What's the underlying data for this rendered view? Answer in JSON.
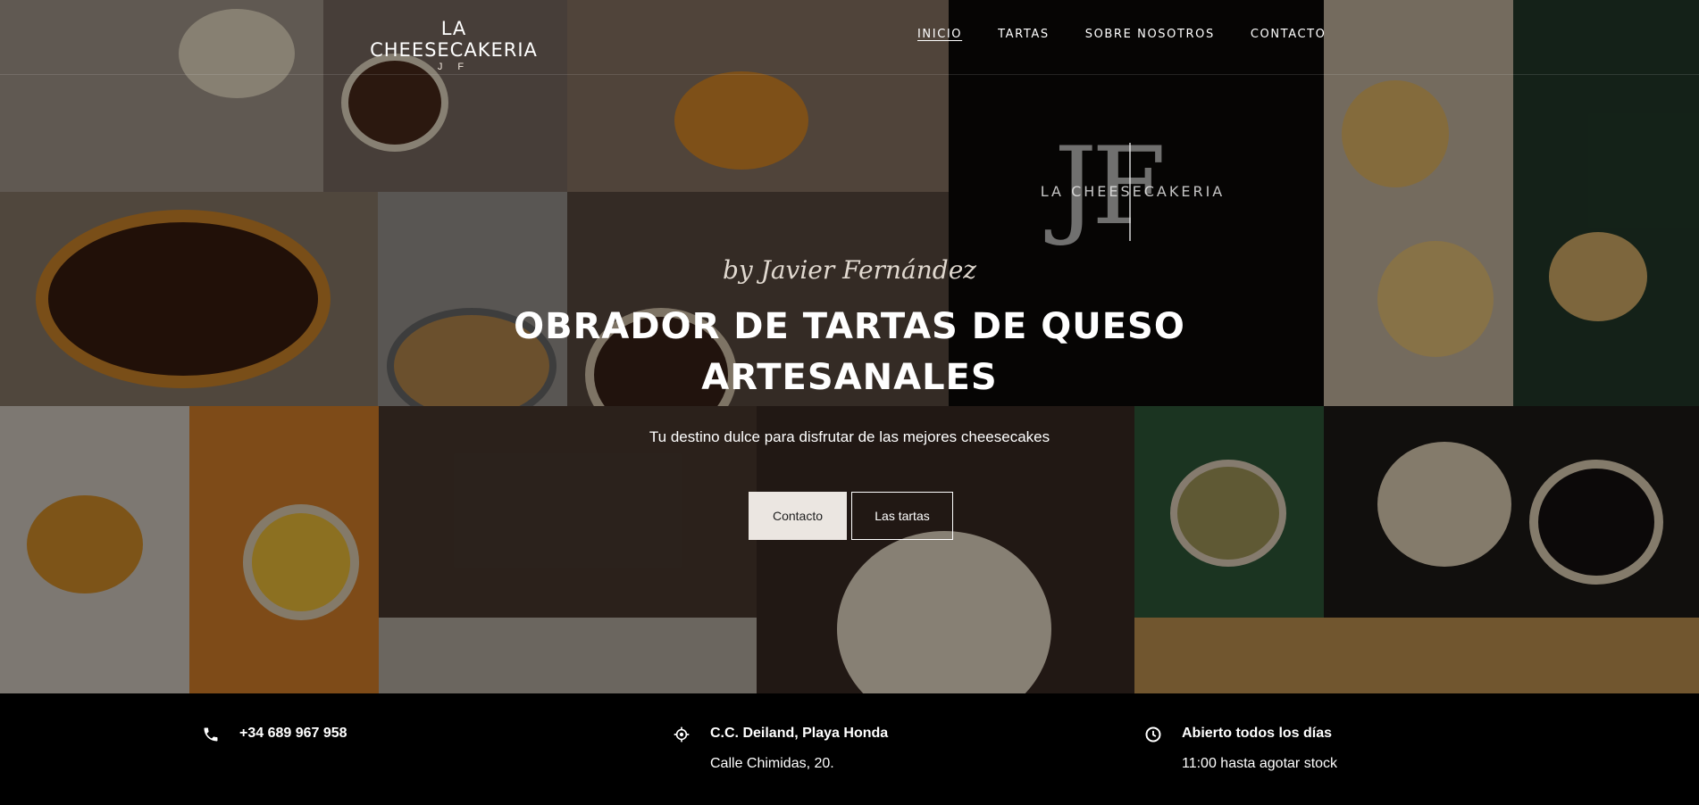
{
  "brand": {
    "name": "LA CHEESECAKERIA",
    "initials": "J F"
  },
  "nav": [
    {
      "label": "INICIO",
      "active": true
    },
    {
      "label": "TARTAS",
      "active": false
    },
    {
      "label": "SOBRE NOSOTROS",
      "active": false
    },
    {
      "label": "CONTACTO",
      "active": false
    }
  ],
  "hero": {
    "logo_letters": "JF",
    "logo_text": "LA CHEESECAKERIA",
    "byline": "by Javier Fernández",
    "headline": "OBRADOR DE TARTAS DE QUESO ARTESANALES",
    "subline": "Tu destino dulce para disfrutar de las mejores cheesecakes",
    "buttons": {
      "contact": "Contacto",
      "cakes": "Las tartas"
    }
  },
  "info": {
    "phone": "+34 689 967 958",
    "address_line1": "C.C. Deiland, Playa Honda",
    "address_line2": "Calle Chimidas, 20.",
    "hours_line1": "Abierto todos los días",
    "hours_line2": "11:00 hasta agotar stock"
  },
  "icons": {
    "phone": "phone-icon",
    "location": "location-icon",
    "clock": "clock-icon"
  },
  "colors": {
    "accent_button": "#ebe6e1",
    "background": "#000000"
  }
}
